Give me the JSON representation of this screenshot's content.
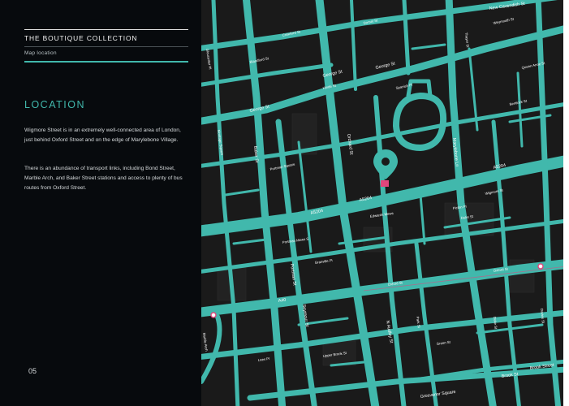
{
  "brand": "THE BOUTIQUE COLLECTION",
  "subtitle": "Map location",
  "heading": "LOCATION",
  "paragraph_1": "Wigmore Street is in an extremely well-connected area of London, just behind Oxford Street and on the edge of Marylebone Village.",
  "paragraph_2": "There is an abundance of transport links, including Bond Street, Marble Arch, and Baker Street stations and access to plenty of bus routes from Oxford Street.",
  "page_number": "05",
  "colors": {
    "panel_background": "#070a0d",
    "accent": "#41b8ac",
    "map_background": "#1a1a1a",
    "road": "#41b8ac",
    "marker": "#41b8ac",
    "highlight": "#e0457b"
  },
  "map": {
    "marker_icon": "map-pin-icon",
    "street_labels": {
      "new_cavendish": "New Cavendish St",
      "george_1": "George St",
      "george_2": "George St",
      "george_3": "George St",
      "a5204_1": "A5204",
      "a5204_2": "A5204",
      "a5204_3": "A5204",
      "a40": "A40",
      "portman_sq": "Portman Square",
      "oxford_st": "Oxford St",
      "oxford_st_2": "Oxford St",
      "brook_st": "Brook St",
      "brook_st_2": "Brook Street",
      "grosvenor_sq": "Grosvenor Square",
      "duke_st": "Duke St",
      "n_audley": "N Audley St",
      "portman_st": "Portman St",
      "seymour_st": "Seymour St",
      "edwards_mews": "Edwards Mews",
      "picton_pl": "Picton Pl",
      "blandford_st": "Blandford St",
      "montagu_sq": "Montagu Square",
      "gloucester_pl": "Gloucester Pl",
      "baker_st": "Baker St",
      "orchard_st": "Orchard St",
      "marylebone_ln": "Marylebone Ln",
      "thayer_st": "Thayer St",
      "wigmore_st": "Wigmore St",
      "bentinck_st": "Bentinck St",
      "duke_st_2": "Duke St",
      "davies_st": "Davies St",
      "green_st": "Green St",
      "upper_brook": "Upper Brook St",
      "park_st": "Park St",
      "crawford_st": "Crawford St",
      "queen_anne": "Queen Anne St",
      "weymouth_st": "Weymouth St",
      "dorset_st": "Dorset St",
      "spanish_pl": "Spanish Pl",
      "hinde_st": "Hinde St",
      "granville_pl": "Granville Pl",
      "portman_mews": "Portman Mews S",
      "lees_pl": "Lees Pl",
      "marble_arch": "Marble Arch"
    }
  }
}
